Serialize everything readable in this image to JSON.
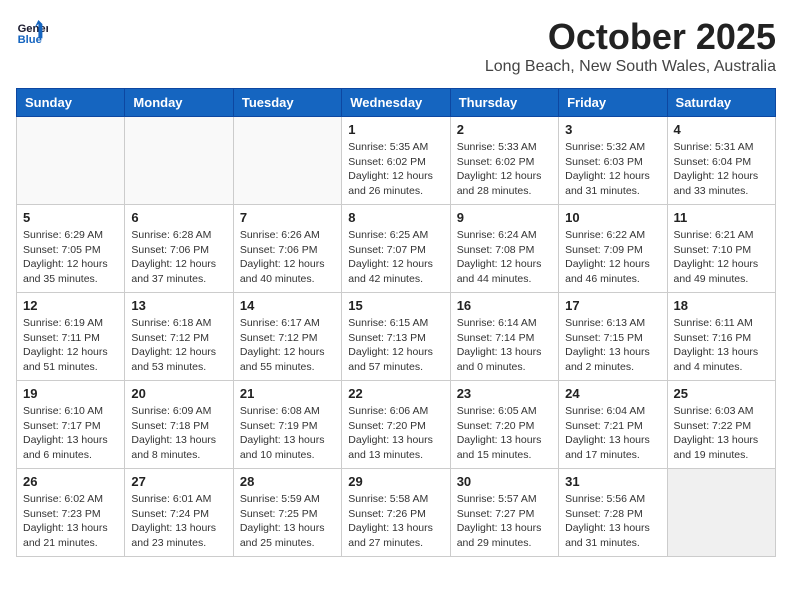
{
  "header": {
    "logo_line1": "General",
    "logo_line2": "Blue",
    "month": "October 2025",
    "location": "Long Beach, New South Wales, Australia"
  },
  "days_of_week": [
    "Sunday",
    "Monday",
    "Tuesday",
    "Wednesday",
    "Thursday",
    "Friday",
    "Saturday"
  ],
  "weeks": [
    [
      {
        "day": "",
        "info": ""
      },
      {
        "day": "",
        "info": ""
      },
      {
        "day": "",
        "info": ""
      },
      {
        "day": "1",
        "info": "Sunrise: 5:35 AM\nSunset: 6:02 PM\nDaylight: 12 hours and 26 minutes."
      },
      {
        "day": "2",
        "info": "Sunrise: 5:33 AM\nSunset: 6:02 PM\nDaylight: 12 hours and 28 minutes."
      },
      {
        "day": "3",
        "info": "Sunrise: 5:32 AM\nSunset: 6:03 PM\nDaylight: 12 hours and 31 minutes."
      },
      {
        "day": "4",
        "info": "Sunrise: 5:31 AM\nSunset: 6:04 PM\nDaylight: 12 hours and 33 minutes."
      }
    ],
    [
      {
        "day": "5",
        "info": "Sunrise: 6:29 AM\nSunset: 7:05 PM\nDaylight: 12 hours and 35 minutes."
      },
      {
        "day": "6",
        "info": "Sunrise: 6:28 AM\nSunset: 7:06 PM\nDaylight: 12 hours and 37 minutes."
      },
      {
        "day": "7",
        "info": "Sunrise: 6:26 AM\nSunset: 7:06 PM\nDaylight: 12 hours and 40 minutes."
      },
      {
        "day": "8",
        "info": "Sunrise: 6:25 AM\nSunset: 7:07 PM\nDaylight: 12 hours and 42 minutes."
      },
      {
        "day": "9",
        "info": "Sunrise: 6:24 AM\nSunset: 7:08 PM\nDaylight: 12 hours and 44 minutes."
      },
      {
        "day": "10",
        "info": "Sunrise: 6:22 AM\nSunset: 7:09 PM\nDaylight: 12 hours and 46 minutes."
      },
      {
        "day": "11",
        "info": "Sunrise: 6:21 AM\nSunset: 7:10 PM\nDaylight: 12 hours and 49 minutes."
      }
    ],
    [
      {
        "day": "12",
        "info": "Sunrise: 6:19 AM\nSunset: 7:11 PM\nDaylight: 12 hours and 51 minutes."
      },
      {
        "day": "13",
        "info": "Sunrise: 6:18 AM\nSunset: 7:12 PM\nDaylight: 12 hours and 53 minutes."
      },
      {
        "day": "14",
        "info": "Sunrise: 6:17 AM\nSunset: 7:12 PM\nDaylight: 12 hours and 55 minutes."
      },
      {
        "day": "15",
        "info": "Sunrise: 6:15 AM\nSunset: 7:13 PM\nDaylight: 12 hours and 57 minutes."
      },
      {
        "day": "16",
        "info": "Sunrise: 6:14 AM\nSunset: 7:14 PM\nDaylight: 13 hours and 0 minutes."
      },
      {
        "day": "17",
        "info": "Sunrise: 6:13 AM\nSunset: 7:15 PM\nDaylight: 13 hours and 2 minutes."
      },
      {
        "day": "18",
        "info": "Sunrise: 6:11 AM\nSunset: 7:16 PM\nDaylight: 13 hours and 4 minutes."
      }
    ],
    [
      {
        "day": "19",
        "info": "Sunrise: 6:10 AM\nSunset: 7:17 PM\nDaylight: 13 hours and 6 minutes."
      },
      {
        "day": "20",
        "info": "Sunrise: 6:09 AM\nSunset: 7:18 PM\nDaylight: 13 hours and 8 minutes."
      },
      {
        "day": "21",
        "info": "Sunrise: 6:08 AM\nSunset: 7:19 PM\nDaylight: 13 hours and 10 minutes."
      },
      {
        "day": "22",
        "info": "Sunrise: 6:06 AM\nSunset: 7:20 PM\nDaylight: 13 hours and 13 minutes."
      },
      {
        "day": "23",
        "info": "Sunrise: 6:05 AM\nSunset: 7:20 PM\nDaylight: 13 hours and 15 minutes."
      },
      {
        "day": "24",
        "info": "Sunrise: 6:04 AM\nSunset: 7:21 PM\nDaylight: 13 hours and 17 minutes."
      },
      {
        "day": "25",
        "info": "Sunrise: 6:03 AM\nSunset: 7:22 PM\nDaylight: 13 hours and 19 minutes."
      }
    ],
    [
      {
        "day": "26",
        "info": "Sunrise: 6:02 AM\nSunset: 7:23 PM\nDaylight: 13 hours and 21 minutes."
      },
      {
        "day": "27",
        "info": "Sunrise: 6:01 AM\nSunset: 7:24 PM\nDaylight: 13 hours and 23 minutes."
      },
      {
        "day": "28",
        "info": "Sunrise: 5:59 AM\nSunset: 7:25 PM\nDaylight: 13 hours and 25 minutes."
      },
      {
        "day": "29",
        "info": "Sunrise: 5:58 AM\nSunset: 7:26 PM\nDaylight: 13 hours and 27 minutes."
      },
      {
        "day": "30",
        "info": "Sunrise: 5:57 AM\nSunset: 7:27 PM\nDaylight: 13 hours and 29 minutes."
      },
      {
        "day": "31",
        "info": "Sunrise: 5:56 AM\nSunset: 7:28 PM\nDaylight: 13 hours and 31 minutes."
      },
      {
        "day": "",
        "info": ""
      }
    ]
  ]
}
